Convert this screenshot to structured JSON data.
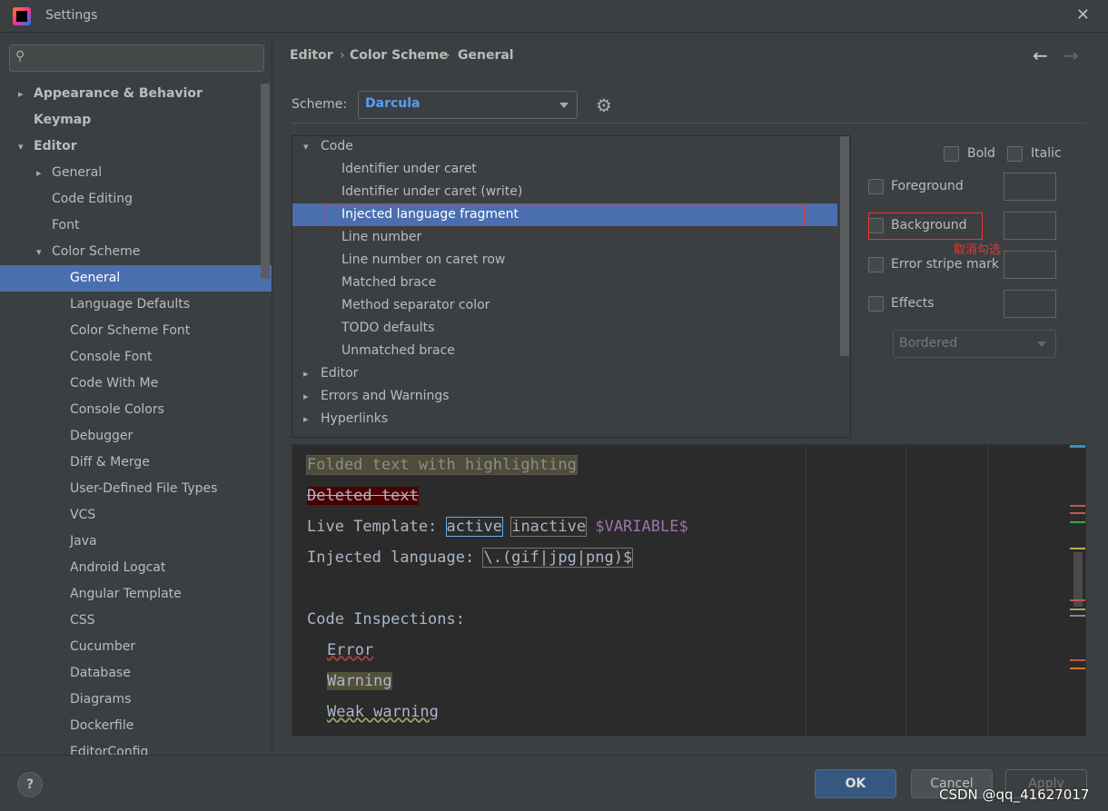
{
  "window": {
    "title": "Settings"
  },
  "sidebar": {
    "search_placeholder": "",
    "items": [
      {
        "label": "Appearance & Behavior",
        "bold": true,
        "arrow": "›",
        "level": 0
      },
      {
        "label": "Keymap",
        "bold": true,
        "level": 0
      },
      {
        "label": "Editor",
        "bold": true,
        "arrow": "⌄",
        "level": 0
      },
      {
        "label": "General",
        "arrow": "›",
        "level": 1
      },
      {
        "label": "Code Editing",
        "level": 1
      },
      {
        "label": "Font",
        "level": 1
      },
      {
        "label": "Color Scheme",
        "arrow": "⌄",
        "level": 1
      },
      {
        "label": "General",
        "level": 2,
        "selected": true
      },
      {
        "label": "Language Defaults",
        "level": 2
      },
      {
        "label": "Color Scheme Font",
        "level": 2
      },
      {
        "label": "Console Font",
        "level": 2
      },
      {
        "label": "Code With Me",
        "level": 2
      },
      {
        "label": "Console Colors",
        "level": 2
      },
      {
        "label": "Debugger",
        "level": 2
      },
      {
        "label": "Diff & Merge",
        "level": 2
      },
      {
        "label": "User-Defined File Types",
        "level": 2
      },
      {
        "label": "VCS",
        "level": 2
      },
      {
        "label": "Java",
        "level": 2
      },
      {
        "label": "Android Logcat",
        "level": 2
      },
      {
        "label": "Angular Template",
        "level": 2
      },
      {
        "label": "CSS",
        "level": 2
      },
      {
        "label": "Cucumber",
        "level": 2
      },
      {
        "label": "Database",
        "level": 2
      },
      {
        "label": "Diagrams",
        "level": 2
      },
      {
        "label": "Dockerfile",
        "level": 2
      },
      {
        "label": "EditorConfig",
        "level": 2
      }
    ]
  },
  "breadcrumb": [
    "Editor",
    "Color Scheme",
    "General"
  ],
  "scheme": {
    "label": "Scheme:",
    "value": "Darcula"
  },
  "tree": [
    {
      "label": "Code",
      "arrow": "⌄",
      "level": 0
    },
    {
      "label": "Identifier under caret",
      "level": 1
    },
    {
      "label": "Identifier under caret (write)",
      "level": 1
    },
    {
      "label": "Injected language fragment",
      "level": 1,
      "selected": true
    },
    {
      "label": "Line number",
      "level": 1
    },
    {
      "label": "Line number on caret row",
      "level": 1
    },
    {
      "label": "Matched brace",
      "level": 1
    },
    {
      "label": "Method separator color",
      "level": 1
    },
    {
      "label": "TODO defaults",
      "level": 1
    },
    {
      "label": "Unmatched brace",
      "level": 1
    },
    {
      "label": "Editor",
      "arrow": "›",
      "level": 0
    },
    {
      "label": "Errors and Warnings",
      "arrow": "›",
      "level": 0
    },
    {
      "label": "Hyperlinks",
      "arrow": "›",
      "level": 0
    }
  ],
  "props": {
    "bold": "Bold",
    "italic": "Italic",
    "foreground": "Foreground",
    "background": "Background",
    "error_stripe": "Error stripe mark",
    "effects": "Effects",
    "effects_type": "Bordered",
    "annotation": "取消勾选"
  },
  "preview": {
    "folded": "Folded text with highlighting",
    "deleted": "Deleted text",
    "live_label": "Live Template: ",
    "live_active": "active",
    "live_inactive": "inactive",
    "live_var": "$VARIABLE$",
    "inj_label": "Injected language: ",
    "inj_value": "\\.(gif|jpg|png)$",
    "inspections": "Code Inspections:",
    "error": "Error",
    "warning": "Warning",
    "weak_warning": "Weak warning"
  },
  "footer": {
    "help": "?",
    "ok": "OK",
    "cancel": "Cancel",
    "apply": "Apply",
    "watermark": "CSDN @qq_41627017"
  },
  "colors": {
    "selection": "#4b6eaf",
    "annotation": "#e33333",
    "variable": "#9876aa",
    "ok": "#365880"
  }
}
